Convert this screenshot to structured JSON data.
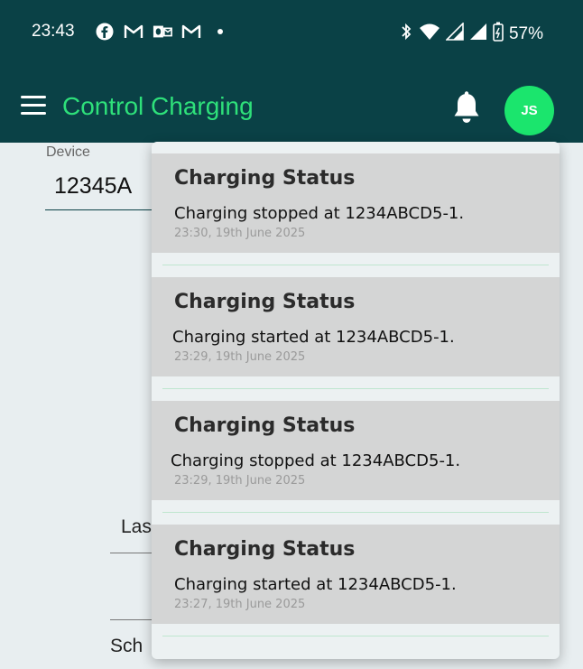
{
  "status_bar": {
    "time": "23:43",
    "left_icons": [
      "facebook-icon",
      "gmail-icon",
      "outlook-icon",
      "gmail-icon",
      "dot-icon"
    ],
    "right_icons": [
      "bluetooth-icon",
      "wifi-icon",
      "signal-icon",
      "signal-icon",
      "battery-icon"
    ],
    "battery": "57%"
  },
  "app_bar": {
    "title": "Control Charging",
    "avatar_initials": "JS",
    "title_color": "#2ee07a",
    "bar_color": "#0a4146",
    "avatar_color": "#1be56d"
  },
  "form": {
    "device_label": "Device",
    "device_value": "12345A",
    "partial_label_1": "Las",
    "partial_label_2": "Sch"
  },
  "notifications": [
    {
      "title": "Charging Status",
      "message": "Charging stopped at 1234ABCD5-1.",
      "time": "23:30, 19th June 2025"
    },
    {
      "title": "Charging Status",
      "message": "Charging started at 1234ABCD5-1.",
      "time": "23:29, 19th June 2025"
    },
    {
      "title": "Charging Status",
      "message": "Charging stopped at 1234ABCD5-1.",
      "time": "23:29, 19th June 2025"
    },
    {
      "title": "Charging Status",
      "message": "Charging started at 1234ABCD5-1.",
      "time": "23:27, 19th June 2025"
    }
  ]
}
